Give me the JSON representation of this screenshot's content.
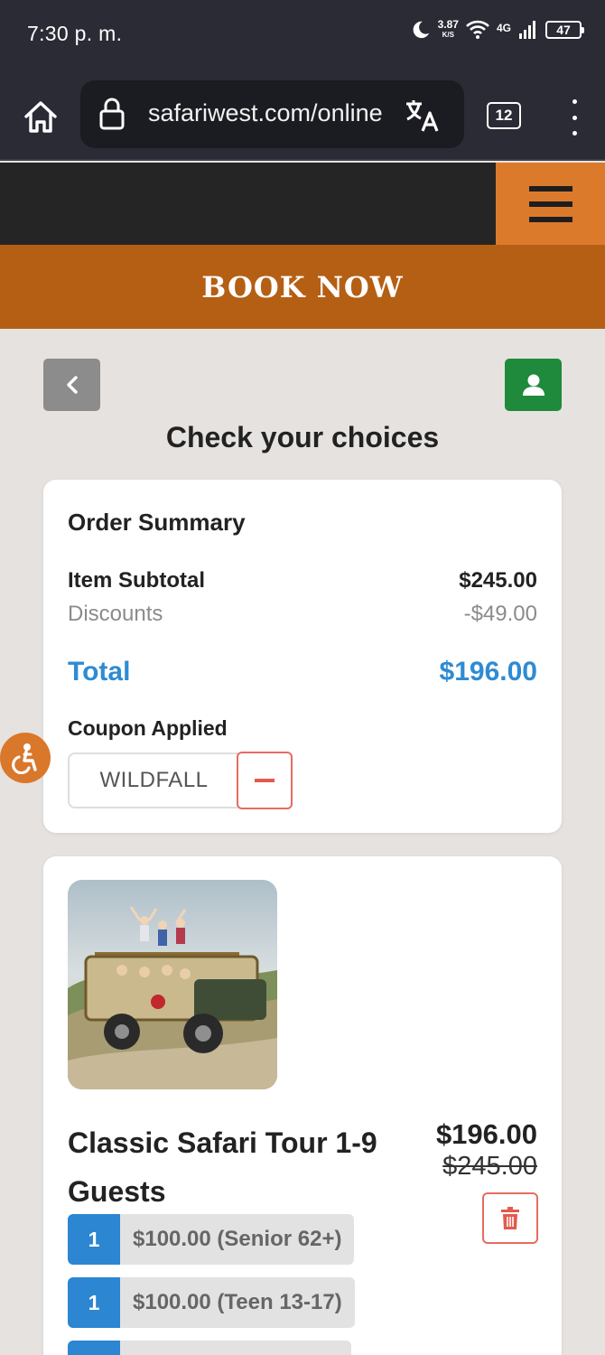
{
  "status_bar": {
    "time": "7:30 p. m.",
    "speed_value": "3.87",
    "speed_unit": "K/S",
    "network": "4G",
    "battery": "47"
  },
  "browser": {
    "url": "safariwest.com/online",
    "tab_count": "12"
  },
  "site": {
    "book_now": "BOOK NOW",
    "page_title": "Check your choices"
  },
  "summary": {
    "title": "Order Summary",
    "subtotal_label": "Item Subtotal",
    "subtotal_value": "$245.00",
    "discount_label": "Discounts",
    "discount_value": "-$49.00",
    "total_label": "Total",
    "total_value": "$196.00",
    "coupon_label": "Coupon Applied",
    "coupon_code": "WILDFALL"
  },
  "item": {
    "title": "Classic Safari Tour 1-9 Guests",
    "price": "$196.00",
    "original_price": "$245.00",
    "tickets": [
      {
        "qty": "1",
        "desc": "$100.00 (Senior 62+)"
      },
      {
        "qty": "1",
        "desc": "$100.00 (Teen 13-17)"
      },
      {
        "qty": "",
        "desc": ""
      }
    ]
  },
  "colors": {
    "header_dark": "#252525",
    "accent_orange": "#dc7a2c",
    "book_now_bg": "#b55f14",
    "total_blue": "#2e8bd3",
    "remove_red": "#e35b4e",
    "user_green": "#1f8a3b"
  },
  "icons": {
    "home": "home-icon",
    "lock": "lock-icon",
    "translate": "translate-icon",
    "menu": "hamburger-icon",
    "back": "chevron-left-icon",
    "user": "user-icon",
    "accessibility": "accessibility-icon",
    "remove": "minus-icon",
    "delete": "trash-icon"
  }
}
